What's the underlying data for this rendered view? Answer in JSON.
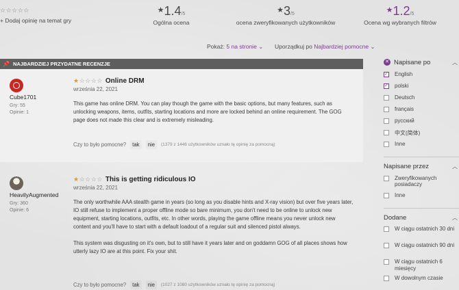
{
  "top": {
    "add_opinion_stars": "☆☆☆☆☆",
    "add_opinion": "+ Dodaj opinię na temat gry",
    "scores": [
      {
        "value": "1.4",
        "denominator": "/5",
        "label": "Ogólna ocena"
      },
      {
        "value": "3",
        "denominator": "/5",
        "label": "ocena zweryfikowanych użytkowników"
      },
      {
        "value": "1.2",
        "denominator": "/5",
        "label": "Ocena wg wybranych filtrów"
      }
    ]
  },
  "sort": {
    "show_label": "Pokaż:",
    "show_value": "5 na stronie",
    "order_label": "Uporządkuj po",
    "order_value": "Najbardziej pomocne"
  },
  "section_title": "NAJBARDZIEJ PRZYDATNE RECENZJE",
  "reviews": [
    {
      "author": "Cube1701",
      "games": "Gry: 55",
      "opinions": "Opinie: 1",
      "rating": 1,
      "title": "Online DRM",
      "date": "września 22, 2021",
      "paragraphs": [
        "This game has online DRM. You can play though the game with the basic options, but many features, such as unlocking weapons, items, outfits, starting locations and more are locked behind an online requirement. The GOG page does not made this clear and is extremely misleading."
      ],
      "helpful_q": "Czy to było pomocne?",
      "yes": "tak",
      "no": "nie",
      "helpful_count": "(1379 z 1446 użytkowników uznało tę opinię za pomocną)"
    },
    {
      "author": "HeavilyAugmented",
      "games": "Gry: 360",
      "opinions": "Opinie: 6",
      "rating": 1,
      "title": "This is getting ridiculous IO",
      "date": "września 22, 2021",
      "paragraphs": [
        "The only worthwhile AAA stealth game in years (so long as you disable hints and X-ray vision) but over five years later, IO still refuse to implement a proper offline mode so bare minimum, you don't need to be online to unlock new equipment, starting locations, outfits, etc. In other words, playing the game offline means you never unlock new content and you'll have to start with a default loadout of a regular suit and silenced pistol always.",
        "This system was disgusting on it's own, but to still have it years later and on goddamn GOG of all places shows how utterly lazy IO are at this point. Fix your shit."
      ],
      "helpful_q": "Czy to było pomocne?",
      "yes": "tak",
      "no": "nie",
      "helpful_count": "(1027 z 1080 użytkowników uznało tę opinię za pomocną)"
    }
  ],
  "filters": {
    "languages_head": "Napisane po",
    "languages": [
      {
        "label": "English",
        "checked": true
      },
      {
        "label": "polski",
        "checked": true
      },
      {
        "label": "Deutsch",
        "checked": false
      },
      {
        "label": "français",
        "checked": false
      },
      {
        "label": "русский",
        "checked": false
      },
      {
        "label": "中文(简体)",
        "checked": false
      },
      {
        "label": "Inne",
        "checked": false
      }
    ],
    "author_head": "Napisane przez",
    "authors": [
      {
        "label": "Zweryfikowanych posiadaczy",
        "checked": false
      },
      {
        "label": "Inne",
        "checked": false
      }
    ],
    "added_head": "Dodane",
    "added": [
      {
        "label": "W ciągu ostatnich 30 dni",
        "checked": false
      },
      {
        "label": "W ciągu ostatnich 90 dni",
        "checked": false
      },
      {
        "label": "W ciągu ostatnich 6 miesięcy",
        "checked": false
      },
      {
        "label": "W dowolnym czasie",
        "checked": false
      }
    ]
  },
  "colors": {
    "accent": "#7b3d8e",
    "star": "#e39a16",
    "header": "#5e5e5e"
  }
}
